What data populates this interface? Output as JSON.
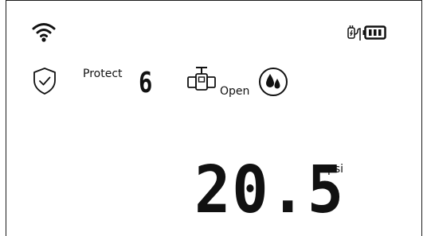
{
  "status": {
    "wifi_icon": "wifi-icon",
    "power_adapter_icon": "power-adapter-icon",
    "battery_icon": "battery-icon",
    "battery_level": 1.0
  },
  "protection": {
    "icon": "shield-check-icon",
    "label": "Protect",
    "level": "6"
  },
  "valve": {
    "icon": "valve-icon",
    "state_label": "Open",
    "water_icon": "water-drops-icon"
  },
  "pressure": {
    "value": "20.5",
    "unit": "psi"
  },
  "colors": {
    "foreground": "#111111",
    "background": "#ffffff"
  }
}
